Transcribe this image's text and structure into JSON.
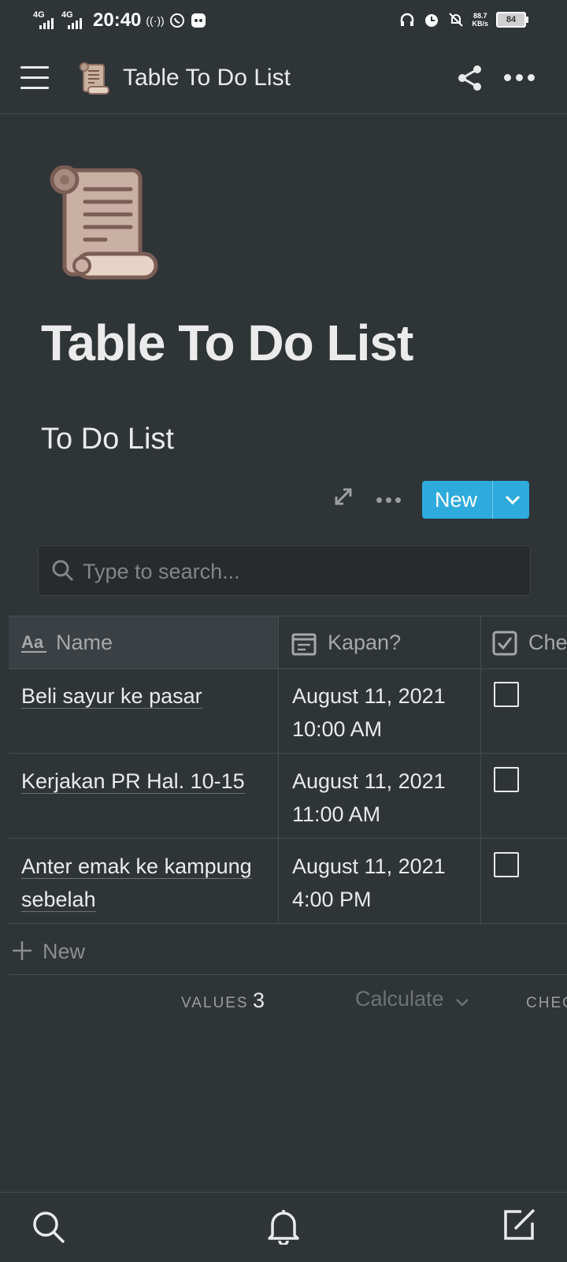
{
  "status_bar": {
    "net1": "4G",
    "net2": "4G",
    "time": "20:40",
    "speed_value": "88.7",
    "speed_unit": "KB/s",
    "battery": "84"
  },
  "topbar": {
    "page_emoji": "📜",
    "title": "Table To Do List"
  },
  "page": {
    "title": "Table To Do List",
    "database_title": "To Do List"
  },
  "actions": {
    "new_label": "New"
  },
  "search": {
    "placeholder": "Type to search..."
  },
  "table": {
    "columns": [
      {
        "label": "Name",
        "icon": "text-property-icon"
      },
      {
        "label": "Kapan?",
        "icon": "calendar-icon"
      },
      {
        "label": "Che",
        "icon": "checkbox-icon"
      }
    ],
    "rows": [
      {
        "name": "Beli sayur ke pasar",
        "date": "August 11, 2021",
        "time": "10:00 AM",
        "checked": false
      },
      {
        "name": "Kerjakan PR Hal. 10-15",
        "date": "August 11, 2021",
        "time": "11:00 AM",
        "checked": false
      },
      {
        "name": "Anter emak ke kampung sebelah",
        "date": "August 11, 2021",
        "time": "4:00 PM",
        "checked": false
      }
    ],
    "new_row_label": "New"
  },
  "calculations": {
    "values_label": "VALUES",
    "values_count": "3",
    "calculate_label": "Calculate",
    "check_label": "CHEC"
  },
  "colors": {
    "background": "#2f3437",
    "accent": "#2eaadc",
    "header_cell": "#3b4044"
  }
}
